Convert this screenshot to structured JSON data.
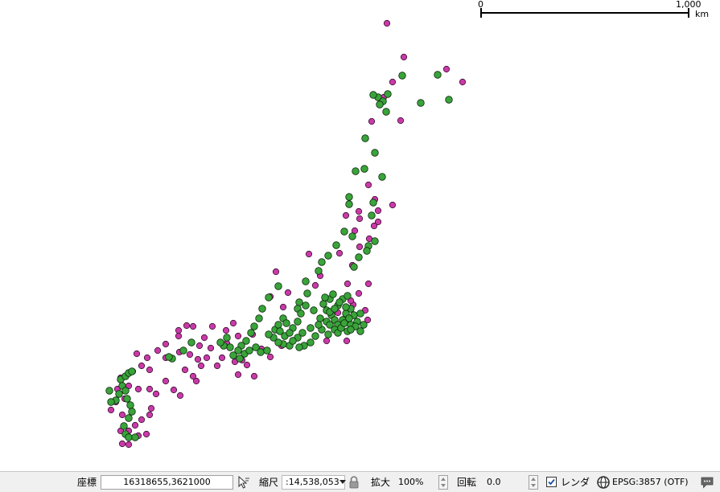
{
  "map": {
    "background": "#ffffff",
    "layers": [
      {
        "name": "magenta-points",
        "color": "#c93aa8",
        "outline": "#3a1030"
      },
      {
        "name": "green-points",
        "color": "#3aa43a",
        "outline": "#0d2a0d"
      }
    ]
  },
  "scale_bar": {
    "start_label": "0",
    "end_label": "1,000",
    "unit": "km"
  },
  "status_bar": {
    "coordinate_label": "座標",
    "coordinate_value": "16318655,3621000",
    "scale_label": "縮尺",
    "scale_value": ":14,538,053",
    "magnifier_label": "拡大",
    "magnifier_value": "100%",
    "rotation_label": "回転",
    "rotation_value": "0.0",
    "render_label": "レンダ",
    "render_checked": true,
    "crs_label": "EPSG:3857 (OTF)",
    "icons": {
      "coord_toggle": "mouse-pointer-icon",
      "lock": "lock-icon",
      "crs": "globe-icon",
      "messages": "speech-bubble-icon"
    }
  }
}
